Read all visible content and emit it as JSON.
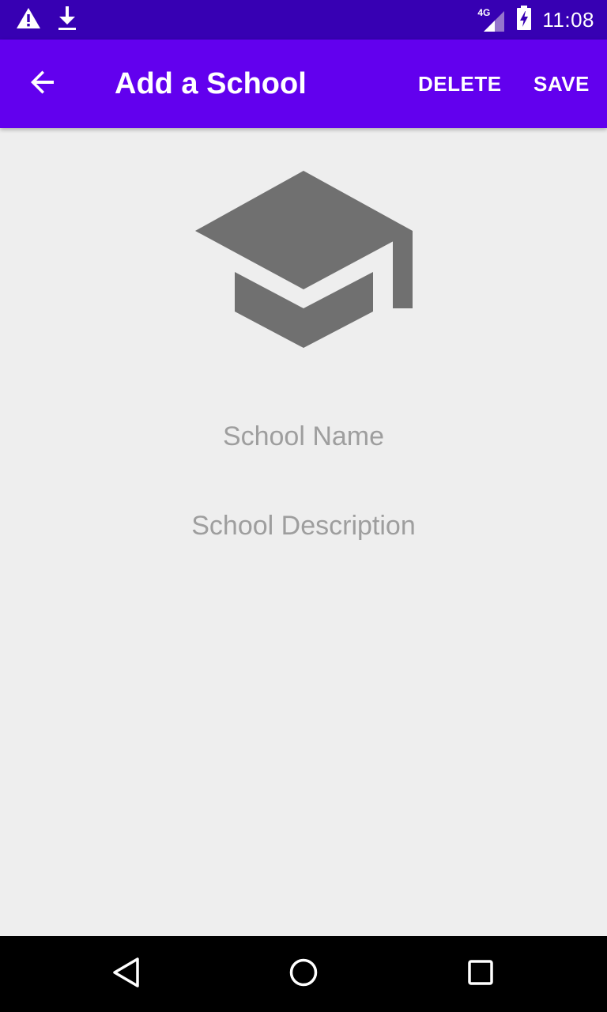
{
  "status_bar": {
    "time": "11:08",
    "network_type": "4G",
    "icons": [
      "warning-icon",
      "download-icon",
      "cell-signal-icon",
      "battery-charging-icon"
    ]
  },
  "app_bar": {
    "title": "Add a School",
    "back_icon": "arrow-back-icon",
    "delete_label": "DELETE",
    "save_label": "SAVE"
  },
  "content": {
    "icon": "graduation-cap-icon",
    "school_name_placeholder": "School Name",
    "school_description_placeholder": "School Description"
  },
  "nav_bar": {
    "icons": [
      "nav-back-icon",
      "nav-home-icon",
      "nav-recents-icon"
    ]
  },
  "colors": {
    "status_bar": "#3700b3",
    "app_bar": "#6200ee",
    "background": "#eeeeee",
    "icon": "#707070",
    "hint_text": "#9e9e9e",
    "nav_bar": "#000000"
  }
}
